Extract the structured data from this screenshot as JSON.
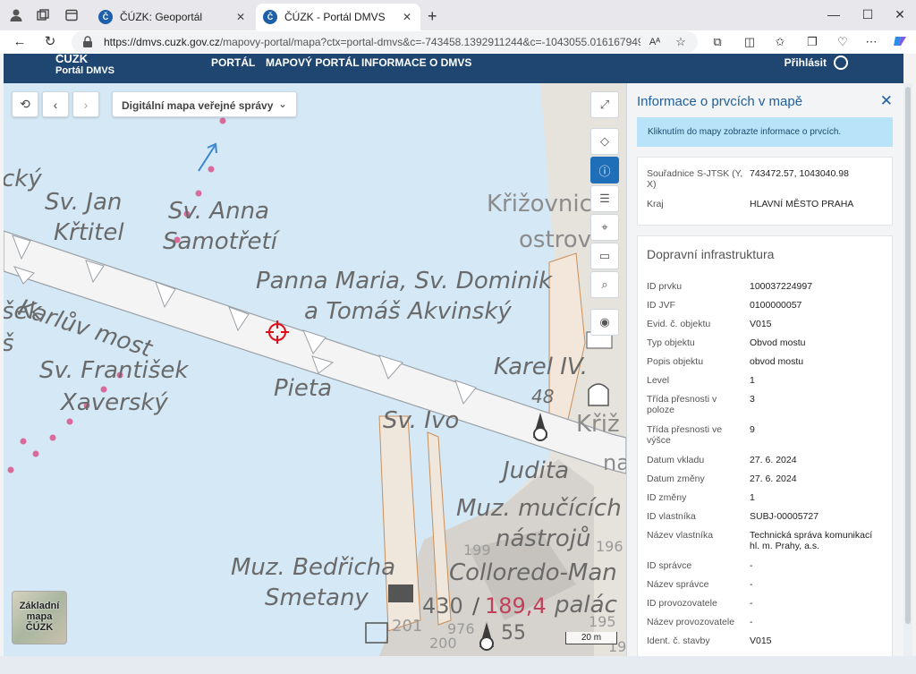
{
  "browser": {
    "tabs": [
      {
        "title": "ČÚZK: Geoportál",
        "active": false
      },
      {
        "title": "ČÚZK - Portál DMVS",
        "active": true
      }
    ],
    "url_domain": "https://dmvs.cuzk.gov.cz",
    "url_rest": "/mapovy-portal/mapa?ctx=portal-dmvs&c=-743458.1392911244&c=-1043055.0161679499&z=19..."
  },
  "header": {
    "logo_line1": "ČÚZK",
    "logo_line2": "Portál DMVS",
    "menu": [
      "PORTÁL",
      "MAPOVÝ PORTÁL",
      "INFORMACE O DMVS"
    ],
    "login": "Přihlásit"
  },
  "map": {
    "basemap_select": "Digitální mapa veřejné správy",
    "basemap_button": [
      "Základní",
      "mapa",
      "ČÚZK"
    ],
    "scale": "20 m",
    "labels": {
      "cky": "cký",
      "sv_jan": "Sv. Jan",
      "kritel": "Křtitel",
      "sv_anna": "Sv. Anna",
      "samotreti": "Samotřetí",
      "krizovnic": "Křižovnic",
      "ostrov": "ostrov",
      "panna": "Panna Maria, Sv. Dominik",
      "tomas": "a Tomáš Akvinský",
      "karluv": "Karlův most",
      "sek": "šek",
      "s": "š",
      "sv_frantisek": "Sv. František",
      "xaversky": "Xaverský",
      "pieta": "Pieta",
      "karel": "Karel IV.",
      "n48": "48",
      "sv_ivo": "Sv. Ivo",
      "kriz": "Křiž",
      "judita": "Judita",
      "na": "na",
      "muz_mucicich": "Muz. mučících",
      "nastroju": "nástrojů",
      "n199": "199",
      "n196": "196",
      "muz_bedricha": "Muz. Bedřicha",
      "colloredo": "Colloredo-Man",
      "smetany": "Smetany",
      "palac": "palác",
      "n430": "430",
      "n189": "189,4",
      "n201": "201",
      "n976": "976",
      "n200": "200",
      "n55": "55",
      "n195": "195",
      "n19": "19"
    }
  },
  "panel": {
    "title": "Informace o prvcích v mapě",
    "hint": "Kliknutím do mapy zobrazte informace o prvcích.",
    "coords": [
      {
        "k": "Souřadnice S-JTSK (Y, X)",
        "v": "743472.57, 1043040.98"
      },
      {
        "k": "Kraj",
        "v": "HLAVNÍ MĚSTO PRAHA"
      }
    ],
    "section": "Dopravní infrastruktura",
    "attrs": [
      {
        "k": "ID prvku",
        "v": "100037224997"
      },
      {
        "k": "ID JVF",
        "v": "0100000057"
      },
      {
        "k": "Evid. č. objektu",
        "v": "V015"
      },
      {
        "k": "Typ objektu",
        "v": "Obvod mostu"
      },
      {
        "k": "Popis objektu",
        "v": "obvod mostu"
      },
      {
        "k": "Level",
        "v": "1"
      },
      {
        "k": "Třída přesnosti v poloze",
        "v": "3"
      },
      {
        "k": "Třída přesnosti ve výšce",
        "v": "9"
      },
      {
        "k": "Datum vkladu",
        "v": "27. 6. 2024"
      },
      {
        "k": "Datum změny",
        "v": "27. 6. 2024"
      },
      {
        "k": "ID změny",
        "v": "1"
      },
      {
        "k": "ID vlastníka",
        "v": "SUBJ-00005727"
      },
      {
        "k": "Název vlastníka",
        "v": "Technická správa komunikací hl. m. Prahy, a.s."
      },
      {
        "k": "ID správce",
        "v": "-"
      },
      {
        "k": "Název správce",
        "v": "-"
      },
      {
        "k": "ID provozovatele",
        "v": "-"
      },
      {
        "k": "Název provozovatele",
        "v": "-"
      },
      {
        "k": "Ident. č. stavby",
        "v": "V015"
      }
    ]
  },
  "colors": {
    "header_bg": "#1f4670",
    "water": "#d4e8f5",
    "bridge": "#f4f4f4",
    "accent": "#1f6fb8",
    "marker": "#e0101a"
  }
}
